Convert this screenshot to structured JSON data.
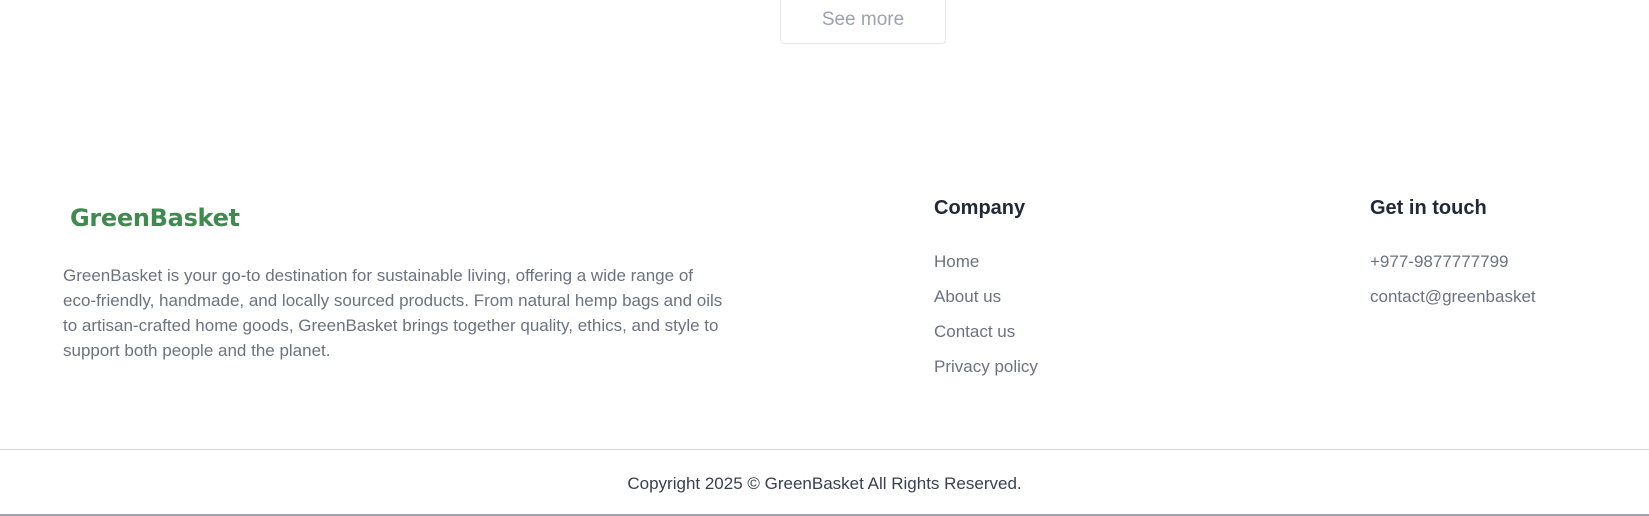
{
  "see_more": {
    "label": "See more"
  },
  "footer": {
    "brand": "GreenBasket",
    "description": "GreenBasket is your go-to destination for sustainable living, offering a wide range of eco-friendly, handmade, and locally sourced products. From natural hemp bags and oils to artisan-crafted home goods, GreenBasket brings together quality, ethics, and style to support both people and the planet.",
    "company": {
      "title": "Company",
      "links": [
        "Home",
        "About us",
        "Contact us",
        "Privacy policy"
      ]
    },
    "contact": {
      "title": "Get in touch",
      "phone": "+977-9877777799",
      "email": "contact@greenbasket"
    },
    "copyright": "Copyright 2025 © GreenBasket All Rights Reserved."
  },
  "colors": {
    "brand": "#3f8a4e",
    "muted_text": "#6b7280",
    "heading": "#1f2937",
    "border": "#e5e7eb"
  }
}
